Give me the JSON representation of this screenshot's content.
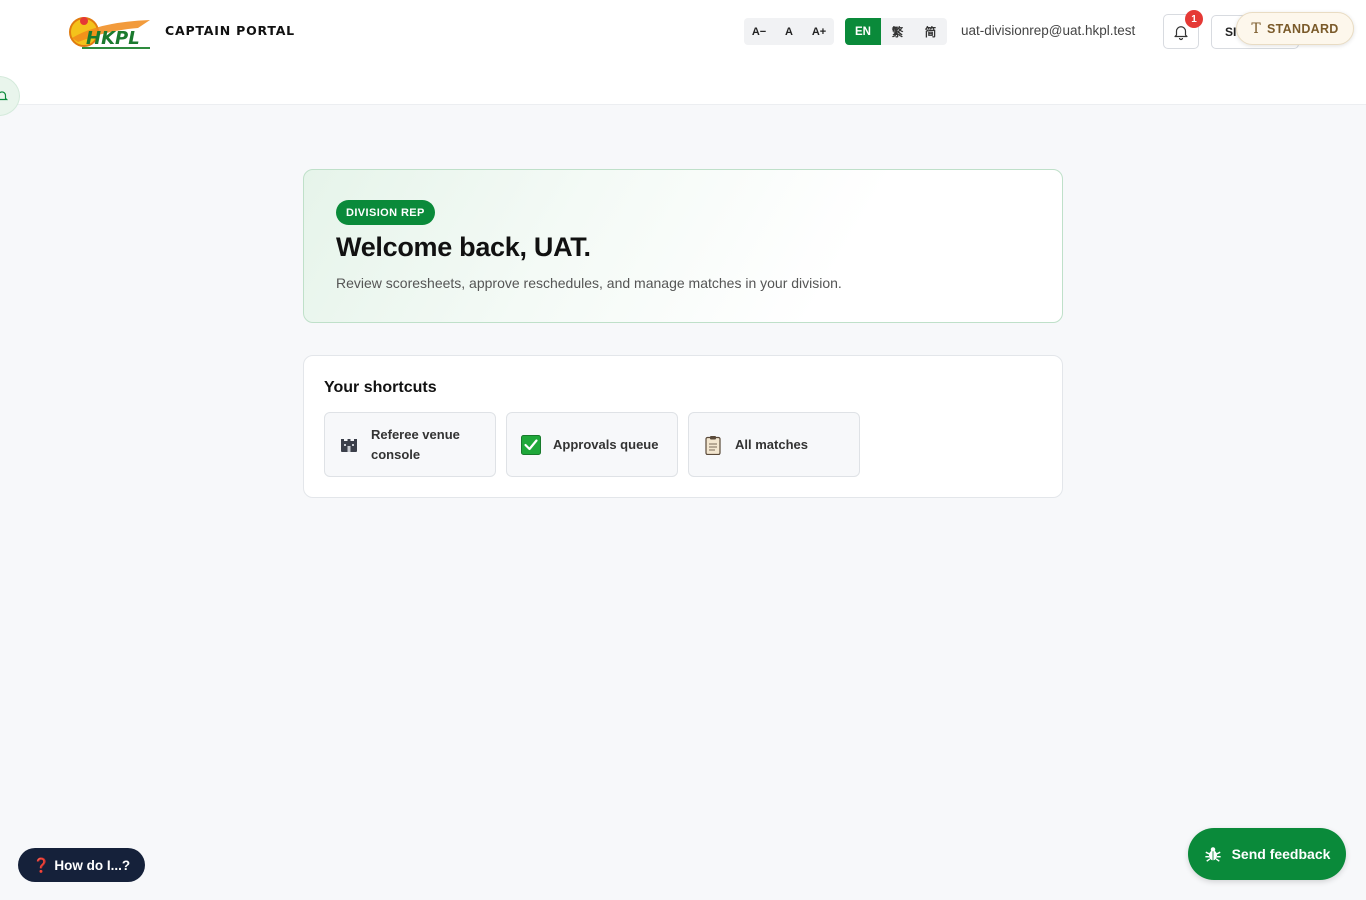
{
  "header": {
    "logo_text": "HKPL",
    "portal_title": "CAPTAIN PORTAL",
    "font_controls": [
      "A−",
      "A",
      "A+"
    ],
    "languages": [
      "EN",
      "繁",
      "简"
    ],
    "active_language": "EN",
    "user_email": "uat-divisionrep@uat.hkpl.test",
    "notification_count": "1",
    "signout_label": "SI",
    "display_mode_label": "STANDARD"
  },
  "welcome": {
    "role_badge": "DIVISION REP",
    "title": "Welcome back, UAT.",
    "subtitle": "Review scoresheets, approve reschedules, and manage matches in your division."
  },
  "shortcuts": {
    "title": "Your shortcuts",
    "items": [
      {
        "label": "Referee venue console",
        "icon": "stadium-icon"
      },
      {
        "label": "Approvals queue",
        "icon": "checkbox-icon"
      },
      {
        "label": "All matches",
        "icon": "clipboard-icon"
      }
    ]
  },
  "help_button": {
    "icon": "❓",
    "label": "How do I...?"
  },
  "feedback_button": {
    "label": "Send feedback",
    "icon": "bug-icon"
  },
  "colors": {
    "brand_green": "#0a8a3a",
    "badge_red": "#e53935",
    "help_navy": "#15213a"
  }
}
